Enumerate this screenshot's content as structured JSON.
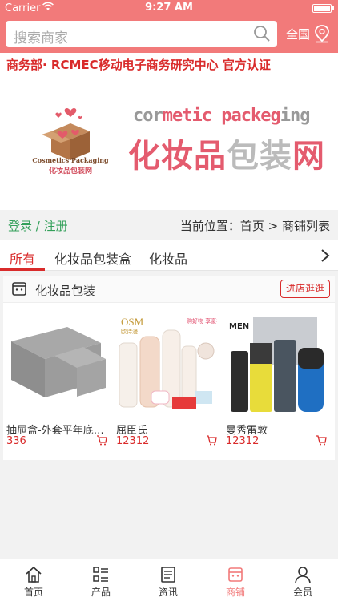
{
  "status": {
    "carrier": "Carrier",
    "time": "9:27 AM"
  },
  "header": {
    "search_placeholder": "搜索商家",
    "region": "全国"
  },
  "cert_text": "商务部· RCMEC移动电子商务研究中心 官方认证",
  "banner": {
    "logo_en": "Cosmetics Packaging",
    "logo_cn": "化妆品包装网",
    "title_en_a": "cor",
    "title_en_b": "metic packeg",
    "title_en_c": "ing",
    "title_cn_a": "化妆品",
    "title_cn_b": "包装",
    "title_cn_c": "网"
  },
  "navbar": {
    "login": "登录 / 注册",
    "breadcrumb": "当前位置：首页 > 商铺列表"
  },
  "tabs": [
    "所有",
    "化妆品包装盒",
    "化妆品"
  ],
  "shop": {
    "name": "化妆品包装",
    "enter_label": "进店逛逛"
  },
  "products": [
    {
      "name": "抽屉盒-外套平年底-…",
      "price": "336"
    },
    {
      "name": "屈臣氏",
      "price": "12312",
      "brand": "OSM",
      "brand_sub": "欧诗漫",
      "promo": "购好物 享豪礼"
    },
    {
      "name": "曼秀雷敦",
      "price": "12312",
      "brand": "MEN"
    }
  ],
  "tabbar": [
    {
      "label": "首页",
      "icon": "home-icon"
    },
    {
      "label": "产品",
      "icon": "list-icon"
    },
    {
      "label": "资讯",
      "icon": "news-icon"
    },
    {
      "label": "商铺",
      "icon": "shop-icon",
      "active": true
    },
    {
      "label": "会员",
      "icon": "user-icon"
    }
  ],
  "colors": {
    "accent": "#f27a7a",
    "red": "#d92b2b",
    "green": "#33a05a"
  }
}
